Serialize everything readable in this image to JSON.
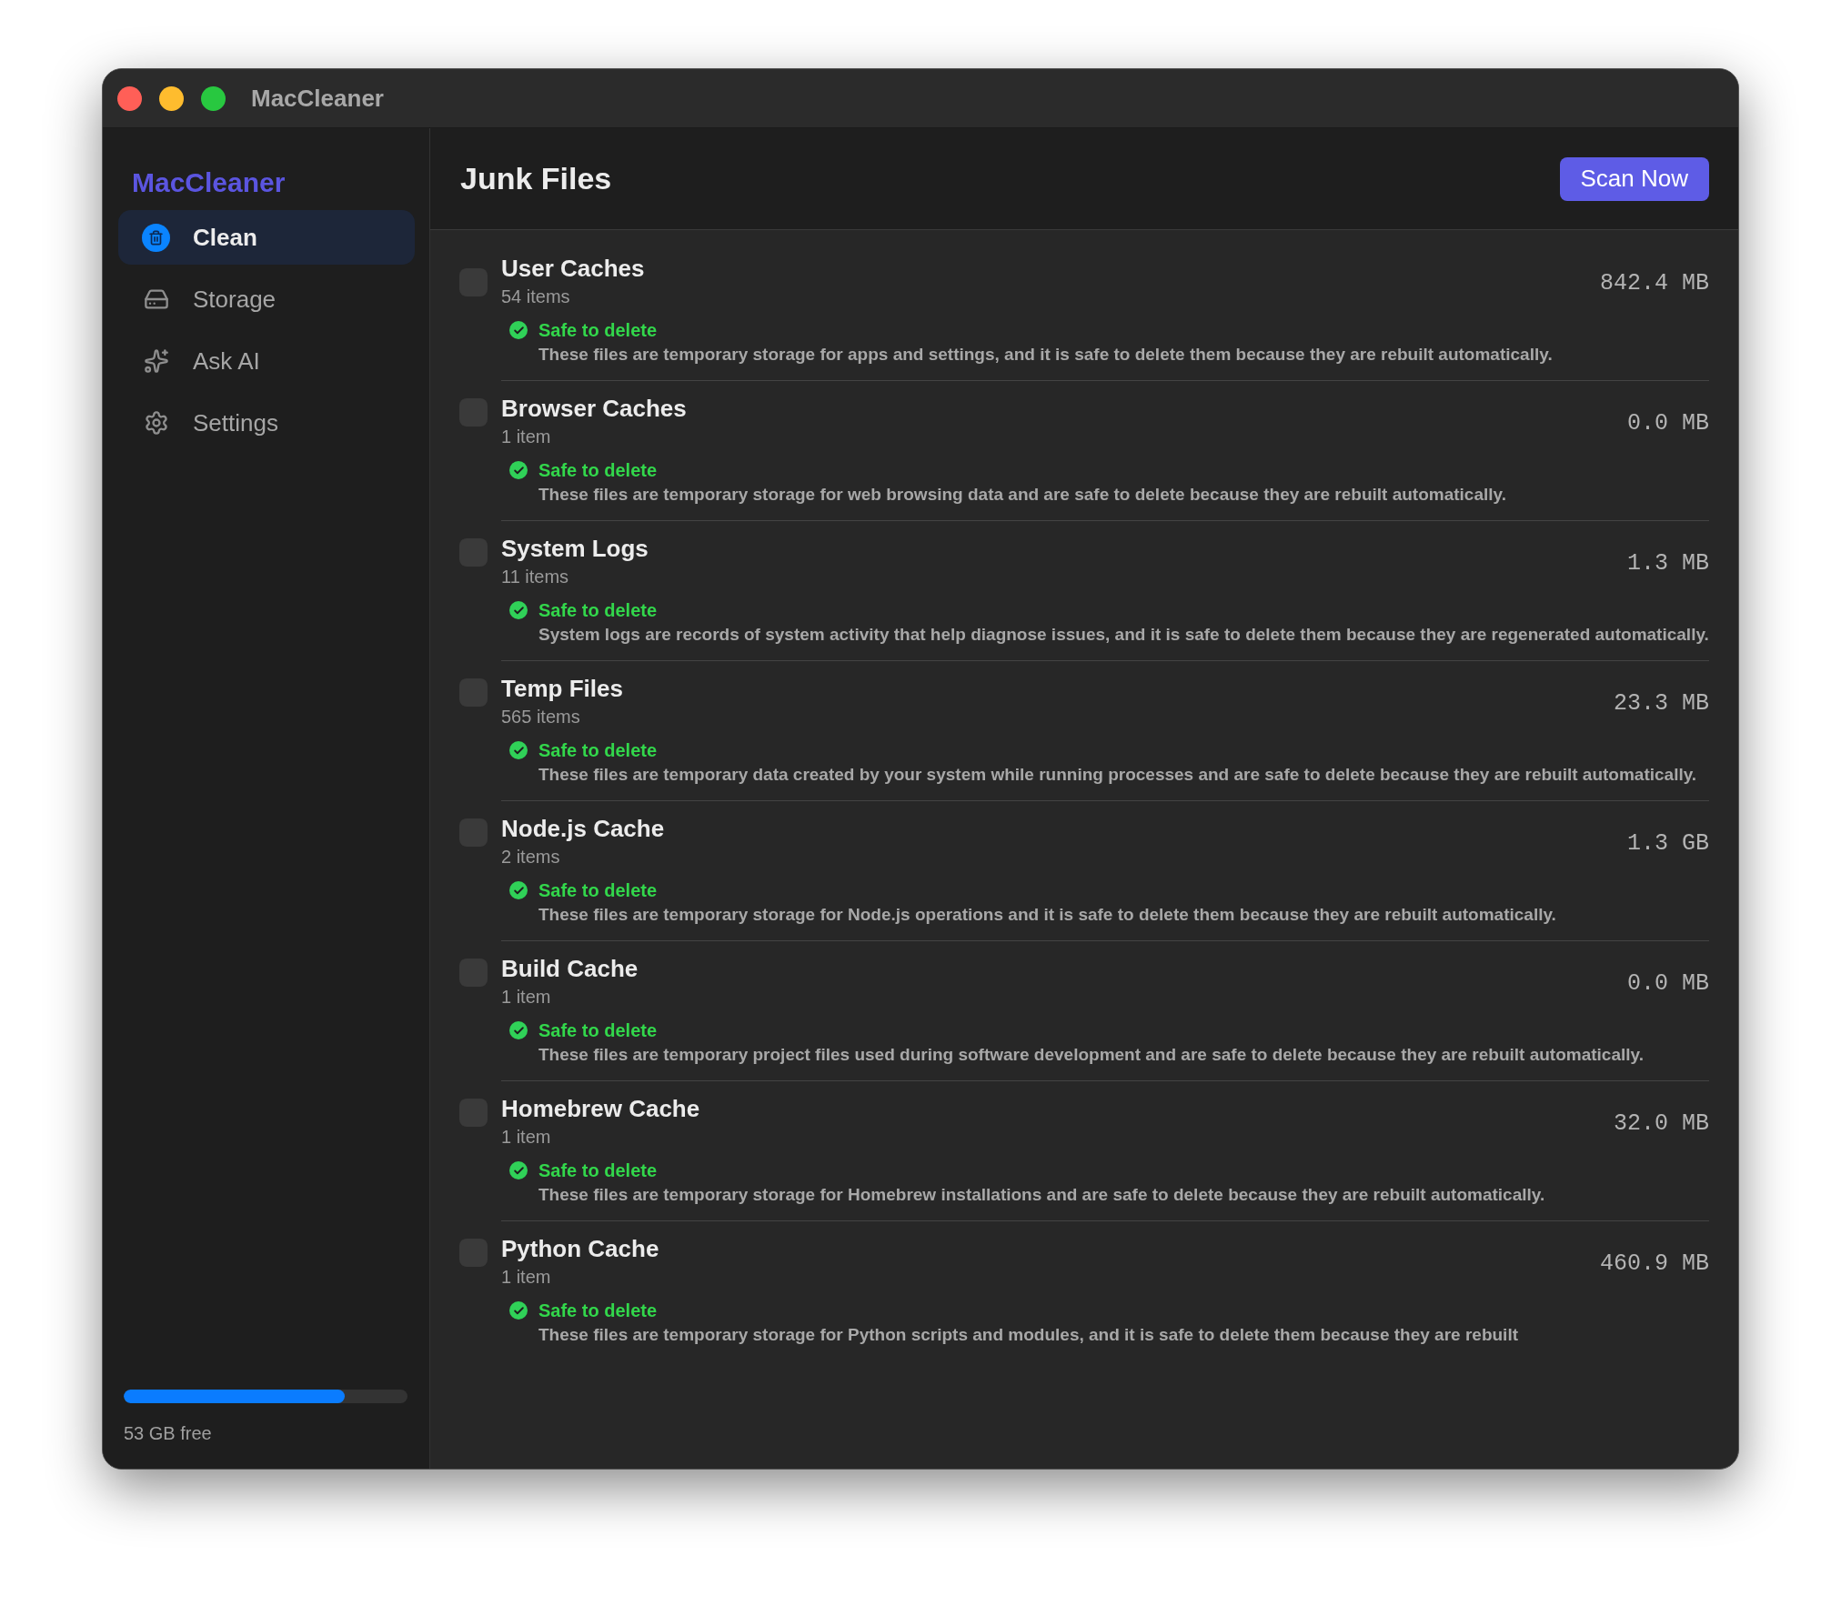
{
  "window": {
    "title": "MacCleaner"
  },
  "sidebar": {
    "logo": "MacCleaner",
    "items": [
      {
        "label": "Clean",
        "selected": true
      },
      {
        "label": "Storage",
        "selected": false
      },
      {
        "label": "Ask AI",
        "selected": false
      },
      {
        "label": "Settings",
        "selected": false
      }
    ],
    "storage": {
      "level": 0.78,
      "label": "53 GB free"
    }
  },
  "header": {
    "title": "Junk Files",
    "button": "Scan Now"
  },
  "items": [
    {
      "name": "User Caches",
      "count": "54 items",
      "size": "842.4 MB",
      "checked": false,
      "status": "Safe to delete",
      "description": "These files are temporary storage for apps and settings, and it is safe to delete them because they are rebuilt automatically."
    },
    {
      "name": "Browser Caches",
      "count": "1 item",
      "size": "0.0 MB",
      "checked": false,
      "status": "Safe to delete",
      "description": "These files are temporary storage for web browsing data and are safe to delete because they are rebuilt automatically."
    },
    {
      "name": "System Logs",
      "count": "11 items",
      "size": "1.3 MB",
      "checked": false,
      "status": "Safe to delete",
      "description": "System logs are records of system activity that help diagnose issues, and it is safe to delete them because they are regenerated automatically."
    },
    {
      "name": "Temp Files",
      "count": "565 items",
      "size": "23.3 MB",
      "checked": false,
      "status": "Safe to delete",
      "description": "These files are temporary data created by your system while running processes and are safe to delete because they are rebuilt automatically."
    },
    {
      "name": "Node.js Cache",
      "count": "2 items",
      "size": "1.3 GB",
      "checked": false,
      "status": "Safe to delete",
      "description": "These files are temporary storage for Node.js operations and it is safe to delete them because they are rebuilt automatically."
    },
    {
      "name": "Build Cache",
      "count": "1 item",
      "size": "0.0 MB",
      "checked": false,
      "status": "Safe to delete",
      "description": "These files are temporary project files used during software development and are safe to delete because they are rebuilt automatically."
    },
    {
      "name": "Homebrew Cache",
      "count": "1 item",
      "size": "32.0 MB",
      "checked": false,
      "status": "Safe to delete",
      "description": "These files are temporary storage for Homebrew installations and are safe to delete because they are rebuilt automatically."
    },
    {
      "name": "Python Cache",
      "count": "1 item",
      "size": "460.9 MB",
      "checked": false,
      "status": "Safe to delete",
      "description": "These files are temporary storage for Python scripts and modules, and it is safe to delete them because they are rebuilt"
    }
  ]
}
